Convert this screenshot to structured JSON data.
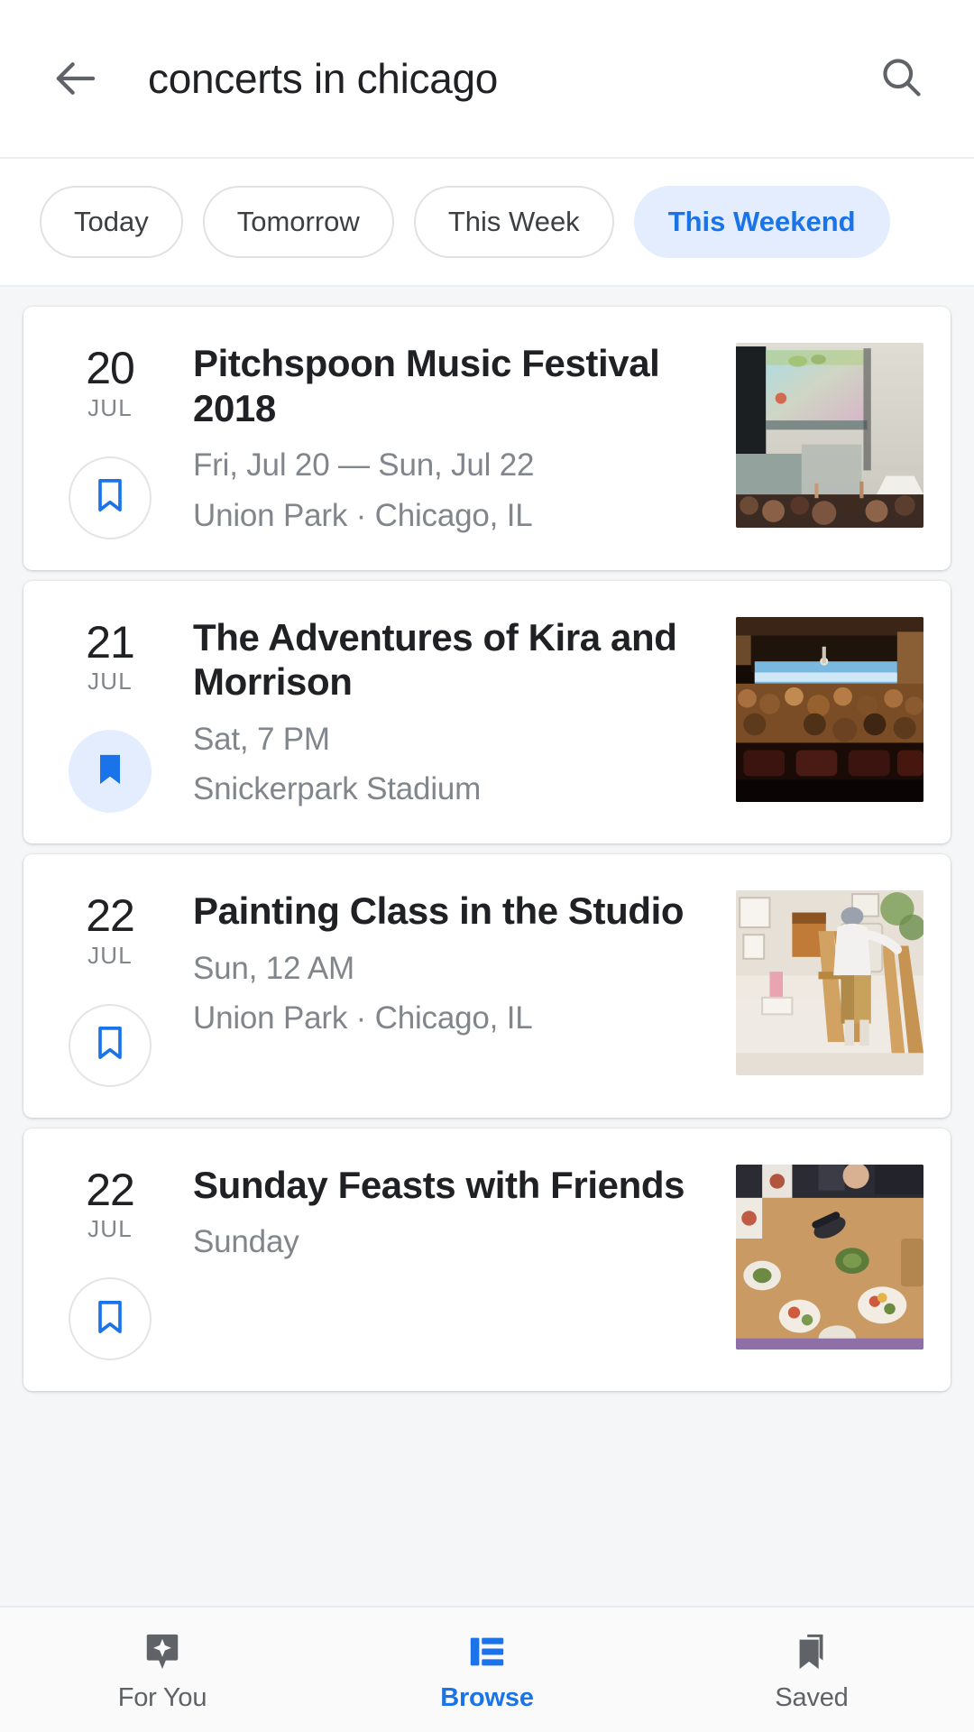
{
  "search": {
    "query": "concerts in chicago",
    "back_icon": "arrow-left-icon",
    "search_icon": "search-icon"
  },
  "filters": {
    "chips": [
      {
        "label": "Today",
        "active": false
      },
      {
        "label": "Tomorrow",
        "active": false
      },
      {
        "label": "This Week",
        "active": false
      },
      {
        "label": "This Weekend",
        "active": true
      }
    ]
  },
  "events": [
    {
      "day": "20",
      "month": "JUL",
      "title": "Pitchspoon Music Festival 2018",
      "when": "Fri, Jul 20 — Sun, Jul 22",
      "where": "Union Park · Chicago, IL",
      "saved": false,
      "bookmark_icon": "bookmark-outline-icon",
      "thumbnail": "music-festival-stage-crowd-photo"
    },
    {
      "day": "21",
      "month": "JUL",
      "title": "The Adventures of Kira and Morrison",
      "when": "Sat, 7 PM",
      "where": "Snickerpark Stadium",
      "saved": true,
      "bookmark_icon": "bookmark-filled-icon",
      "thumbnail": "concert-hall-audience-photo"
    },
    {
      "day": "22",
      "month": "JUL",
      "title": "Painting Class in the Studio",
      "when": "Sun, 12 AM",
      "where": "Union Park · Chicago, IL",
      "saved": false,
      "bookmark_icon": "bookmark-outline-icon",
      "thumbnail": "painting-studio-easel-photo"
    },
    {
      "day": "22",
      "month": "JUL",
      "title": "Sunday Feasts with Friends",
      "when": "Sunday",
      "where": "",
      "saved": false,
      "bookmark_icon": "bookmark-outline-icon",
      "thumbnail": "dinner-table-food-overhead-photo"
    }
  ],
  "bottom_nav": [
    {
      "label": "For You",
      "icon": "sparkle-bubble-icon",
      "active": false
    },
    {
      "label": "Browse",
      "icon": "list-icon",
      "active": true
    },
    {
      "label": "Saved",
      "icon": "bookmarks-icon",
      "active": false
    }
  ],
  "colors": {
    "accent": "#1a73e8",
    "accent_bg": "#e3edfd",
    "text_primary": "#202124",
    "text_secondary": "#80868b",
    "page_bg": "#f5f6f7"
  }
}
